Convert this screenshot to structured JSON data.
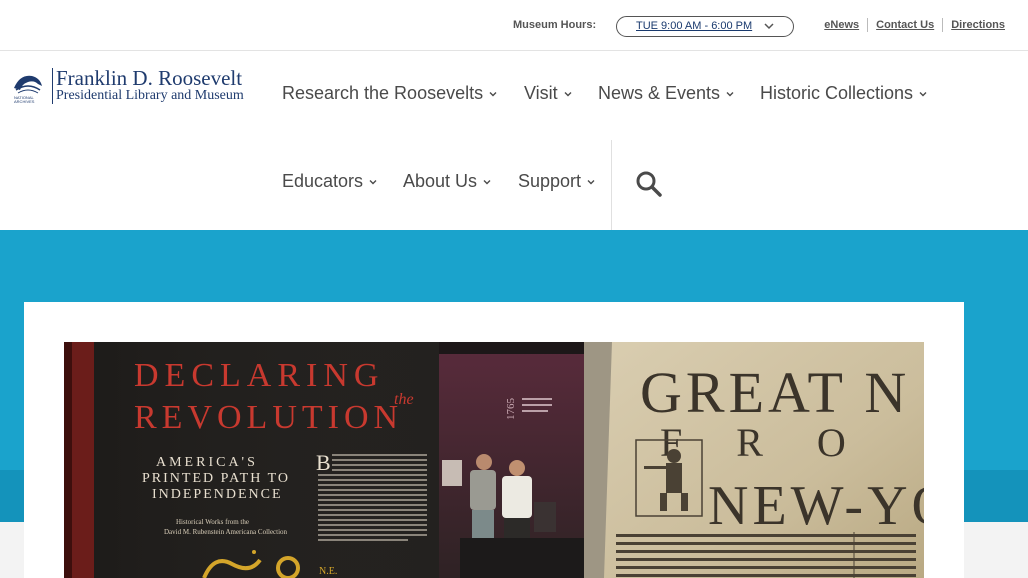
{
  "utility": {
    "hours_label": "Museum Hours:",
    "hours_value": "TUE 9:00 AM - 6:00 PM",
    "links": [
      "eNews",
      "Contact Us",
      "Directions"
    ]
  },
  "logo": {
    "line1": "Franklin D. Roosevelt",
    "line2": "Presidential Library and Museum",
    "seal_text": "NATIONAL ARCHIVES"
  },
  "nav": {
    "research": "Research the Roosevelts",
    "visit": "Visit",
    "news": "News & Events",
    "collections": "Historic Collections",
    "educators": "Educators",
    "about": "About Us",
    "support": "Support"
  },
  "hero": {
    "poster_title_1": "DECLARING",
    "poster_title_the": "the",
    "poster_title_2": "REVOLUTION",
    "poster_sub_1": "AMERICA'S",
    "poster_sub_2": "PRINTED PATH TO",
    "poster_sub_3": "INDEPENDENCE",
    "poster_credit_1": "Historical Works from the",
    "poster_credit_2": "David M. Rubenstein Americana Collection",
    "doc_line1": "GREAT N",
    "doc_line2": "F R O",
    "doc_line3": "NEW-YO"
  },
  "colors": {
    "band": "#1aa3cc",
    "band_lower": "#1493bb",
    "logo_blue": "#1f3b6e",
    "nav_text": "#4a4a4a"
  }
}
